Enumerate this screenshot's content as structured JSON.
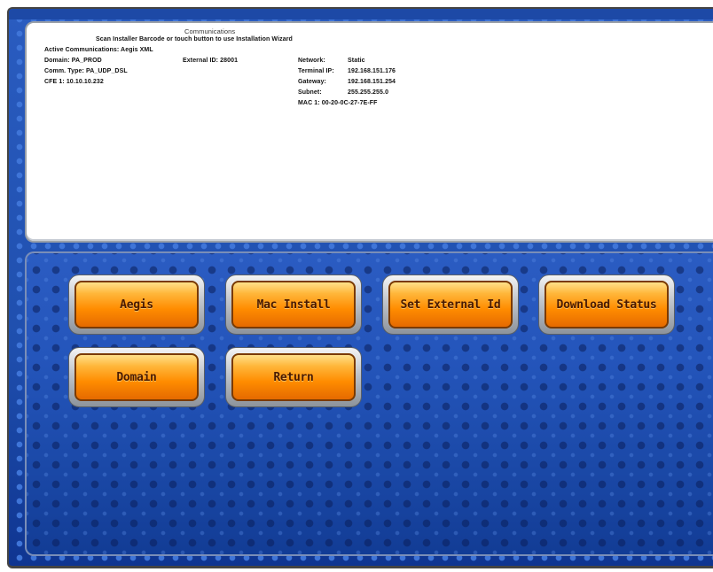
{
  "panel": {
    "title": "Communications",
    "instruction": "Scan Installer Barcode or touch button to use Installation Wizard",
    "active_comms": "Active Communications: Aegis XML",
    "domain": "Domain: PA_PROD",
    "comm_type": "Comm. Type: PA_UDP_DSL",
    "cfe": "CFE 1: 10.10.10.232",
    "external_id": "External ID: 28001",
    "network": {
      "network_label": "Network:",
      "network_value": "Static",
      "terminal_ip_label": "Terminal IP:",
      "terminal_ip_value": "192.168.151.176",
      "gateway_label": "Gateway:",
      "gateway_value": "192.168.151.254",
      "subnet_label": "Subnet:",
      "subnet_value": "255.255.255.0",
      "mac": "MAC 1: 00-20-0C-27-7E-FF"
    }
  },
  "buttons": {
    "aegis": "Aegis",
    "mac_install": "Mac Install",
    "set_external_id": "Set External Id",
    "download_status": "Download Status",
    "domain": "Domain",
    "return": "Return"
  },
  "colors": {
    "background_blue": "#1f4fae",
    "button_orange": "#ff8c00",
    "panel_white": "#ffffff"
  }
}
